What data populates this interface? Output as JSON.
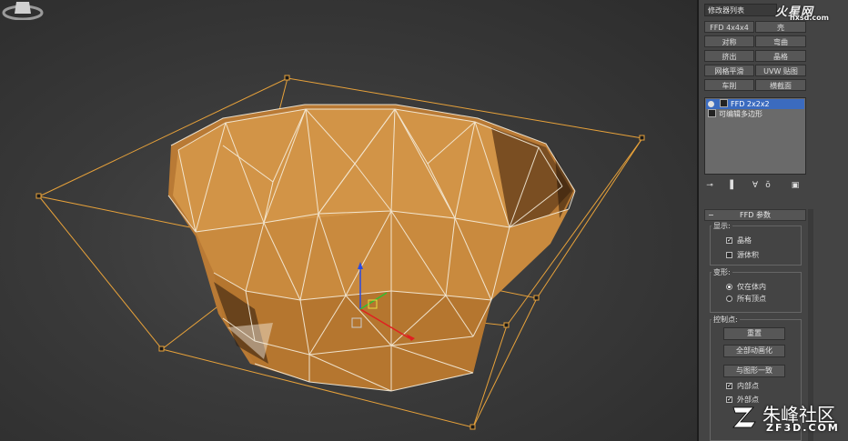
{
  "modifier_list": {
    "label": "修改器列表"
  },
  "watermark_top": {
    "brand": "火星网",
    "url": "hxsd.com"
  },
  "watermark_bottom": {
    "brand": "朱峰社区",
    "url": "ZF3D.COM"
  },
  "modifier_buttons": [
    {
      "label": "FFD 4x4x4"
    },
    {
      "label": "壳"
    },
    {
      "label": "对称"
    },
    {
      "label": "弯曲"
    },
    {
      "label": "挤出"
    },
    {
      "label": "晶格"
    },
    {
      "label": "网格平滑"
    },
    {
      "label": "UVW 贴图"
    },
    {
      "label": "车削"
    },
    {
      "label": "横截面"
    }
  ],
  "stack": {
    "items": [
      {
        "label": "FFD 2x2x2",
        "selected": true
      },
      {
        "label": "可编辑多边形",
        "selected": false
      }
    ]
  },
  "stack_tools": [
    "pin-stack-icon",
    "show-end-result-icon",
    "make-unique-icon",
    "remove-modifier-icon",
    "configure-sets-icon"
  ],
  "ffd_params": {
    "title": "FFD 参数",
    "display": {
      "title": "显示:",
      "lattice": {
        "label": "晶格",
        "checked": true
      },
      "source_volume": {
        "label": "源体积",
        "checked": false
      }
    },
    "deform": {
      "title": "变形:",
      "inside_volume": {
        "label": "仅在体内",
        "selected": true
      },
      "all_vertices": {
        "label": "所有顶点",
        "selected": false
      }
    },
    "control_points": {
      "title": "控制点:",
      "reset": "重置",
      "animate_all": "全部动画化",
      "conform_to_shape": "与图形一致",
      "inside_points": {
        "label": "内部点",
        "checked": true
      },
      "outside_points": {
        "label": "外部点",
        "checked": true
      }
    }
  },
  "colors": {
    "bowl": "#c8893e",
    "lattice": "#e8a23a",
    "selection": "#3b6bbf",
    "axis_x": "#e02020",
    "axis_y": "#30c030",
    "axis_z": "#2a4ae0"
  }
}
